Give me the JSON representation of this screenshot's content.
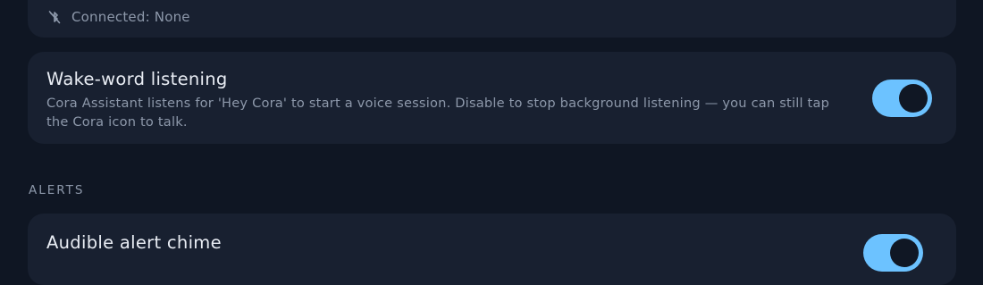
{
  "bluetooth": {
    "status_text": "Connected: None",
    "icon": "bluetooth-disabled-icon"
  },
  "wake_word": {
    "title": "Wake-word listening",
    "description": "Cora Assistant listens for 'Hey Cora' to start a voice session. Disable to stop background listening — you can still tap the Cora icon to talk.",
    "enabled": true
  },
  "alerts": {
    "section_label": "ALERTS",
    "chime": {
      "title": "Audible alert chime",
      "enabled": true
    }
  },
  "colors": {
    "background": "#0f1623",
    "card": "#182030",
    "toggle_on": "#6cc2ff",
    "text_primary": "#e9edf4",
    "text_secondary": "#8d98aa"
  }
}
